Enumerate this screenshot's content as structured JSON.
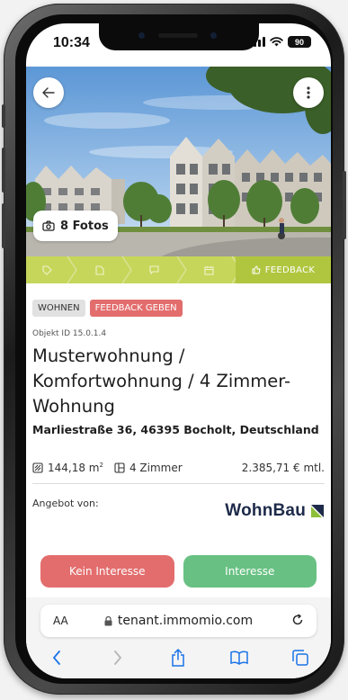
{
  "status_bar": {
    "time": "10:34",
    "battery": "90"
  },
  "listing": {
    "photos_label": "8 Fotos",
    "progress_steps": [
      "tag-icon",
      "document-icon",
      "chat-icon",
      "calendar-icon"
    ],
    "active_step_label": "FEEDBACK",
    "tags": [
      {
        "label": "WOHNEN",
        "color": "#e1e1e1"
      },
      {
        "label": "FEEDBACK GEBEN",
        "color": "#e36d6d"
      }
    ],
    "object_id": "Objekt ID 15.0.1.4",
    "title": "Musterwohnung / Komfortwohnung / 4 Zimmer-Wohnung",
    "address": "Marliestraße 36, 46395 Bocholt, Deutschland",
    "area_value": "144,18 m",
    "area_unit_sup": "2",
    "rooms": "4 Zimmer",
    "price": "2.385,71 € mtl.",
    "offer_label": "Angebot von:",
    "provider_logo": "WohnBau"
  },
  "actions": {
    "no_interest_label": "Kein Interesse",
    "no_interest_color": "#e36d6d",
    "interest_label": "Interesse",
    "interest_color": "#68c183"
  },
  "browser": {
    "text_size_label": "AA",
    "url": "tenant.immomio.com"
  },
  "colors": {
    "progress_bar": "#c6d65a",
    "progress_active": "#b1c63f",
    "accent_blue": "#1a73e8"
  }
}
